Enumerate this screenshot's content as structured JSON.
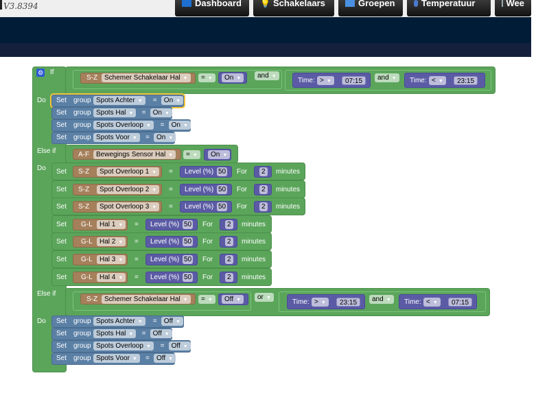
{
  "header": {
    "version": "V3.8394",
    "tabs": [
      {
        "label": "Dashboard",
        "icon": "dashboard-icon"
      },
      {
        "label": "Schakelaars",
        "icon": "lightbulb-icon"
      },
      {
        "label": "Groepen",
        "icon": "scene-icon"
      },
      {
        "label": "Temperatuur",
        "icon": "thermometer-icon"
      },
      {
        "label": "Wee",
        "icon": "weather-icon"
      }
    ]
  },
  "labels": {
    "if": "If",
    "do": "Do",
    "elseif": "Else if",
    "set": "Set",
    "group": "group",
    "eq": "=",
    "for": "For",
    "minutes": "minutes",
    "time": "Time:",
    "level": "Level (%)"
  },
  "if1": {
    "cond": {
      "prefix": "S-Z",
      "device": "Schemer Schakelaar Hal",
      "op": "=",
      "value": "On"
    },
    "logic": "and",
    "time1": {
      "op": ">",
      "value": "07:15"
    },
    "logic2": "and",
    "time2": {
      "op": "<",
      "value": "23:15"
    },
    "actions": [
      {
        "group": "Spots Achter",
        "value": "On"
      },
      {
        "group": "Spots Hal",
        "value": "On"
      },
      {
        "group": "Spots Overloop",
        "value": "On"
      },
      {
        "group": "Spots Voor",
        "value": "On"
      }
    ]
  },
  "elseif1": {
    "cond": {
      "prefix": "A-F",
      "device": "Bewegings Sensor Hal",
      "op": "=",
      "value": "On"
    },
    "actions": [
      {
        "prefix": "S-Z",
        "device": "Spot Overloop 1",
        "level": "50",
        "minutes": "2"
      },
      {
        "prefix": "S-Z",
        "device": "Spot Overloop 2",
        "level": "50",
        "minutes": "2"
      },
      {
        "prefix": "S-Z",
        "device": "Spot Overloop 3",
        "level": "50",
        "minutes": "2"
      },
      {
        "prefix": "G-L",
        "device": "Hal 1",
        "level": "50",
        "minutes": "2"
      },
      {
        "prefix": "G-L",
        "device": "Hal 2",
        "level": "50",
        "minutes": "2"
      },
      {
        "prefix": "G-L",
        "device": "Hal 3",
        "level": "50",
        "minutes": "2"
      },
      {
        "prefix": "G-L",
        "device": "Hal 4",
        "level": "50",
        "minutes": "2"
      }
    ]
  },
  "elseif2": {
    "cond": {
      "prefix": "S-Z",
      "device": "Schemer Schakelaar Hal",
      "op": "=",
      "value": "Off"
    },
    "logic": "or",
    "time1": {
      "op": ">",
      "value": "23:15"
    },
    "logic2": "and",
    "time2": {
      "op": "<",
      "value": "07:15"
    },
    "actions": [
      {
        "group": "Spots Achter",
        "value": "Off"
      },
      {
        "group": "Spots Hal",
        "value": "Off"
      },
      {
        "group": "Spots Overloop",
        "value": "Off"
      },
      {
        "group": "Spots Voor",
        "value": "Off"
      }
    ]
  },
  "colors": {
    "logic": "#5ba55b",
    "group": "#5b80a5",
    "device": "#a5805b",
    "value": "#5b5ba5",
    "selected": "#f2c53a"
  }
}
